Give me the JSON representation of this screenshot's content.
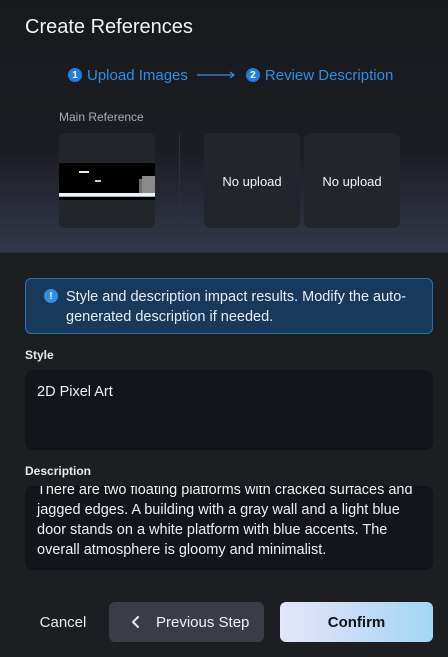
{
  "dialog": {
    "title": "Create References"
  },
  "steps": [
    {
      "number": "1",
      "label": "Upload Images"
    },
    {
      "number": "2",
      "label": "Review Description"
    }
  ],
  "references": {
    "main_label": "Main Reference",
    "slots": [
      {
        "label": "No upload"
      },
      {
        "label": "No upload"
      }
    ]
  },
  "info": {
    "icon": "!",
    "text": "Style and description impact results. Modify the auto-generated description if needed."
  },
  "style": {
    "label": "Style",
    "value": "2D Pixel Art"
  },
  "description": {
    "label": "Description",
    "value": "There are two floating platforms with cracked surfaces and jagged edges. A building with a gray wall and a light blue door stands on a white platform with blue accents. The overall atmosphere is gloomy and minimalist."
  },
  "footer": {
    "cancel_label": "Cancel",
    "prev_label": "Previous Step",
    "confirm_label": "Confirm"
  },
  "colors": {
    "accent": "#2f8fe6",
    "info_bg": "#173a5c",
    "background": "#1c1e22"
  }
}
